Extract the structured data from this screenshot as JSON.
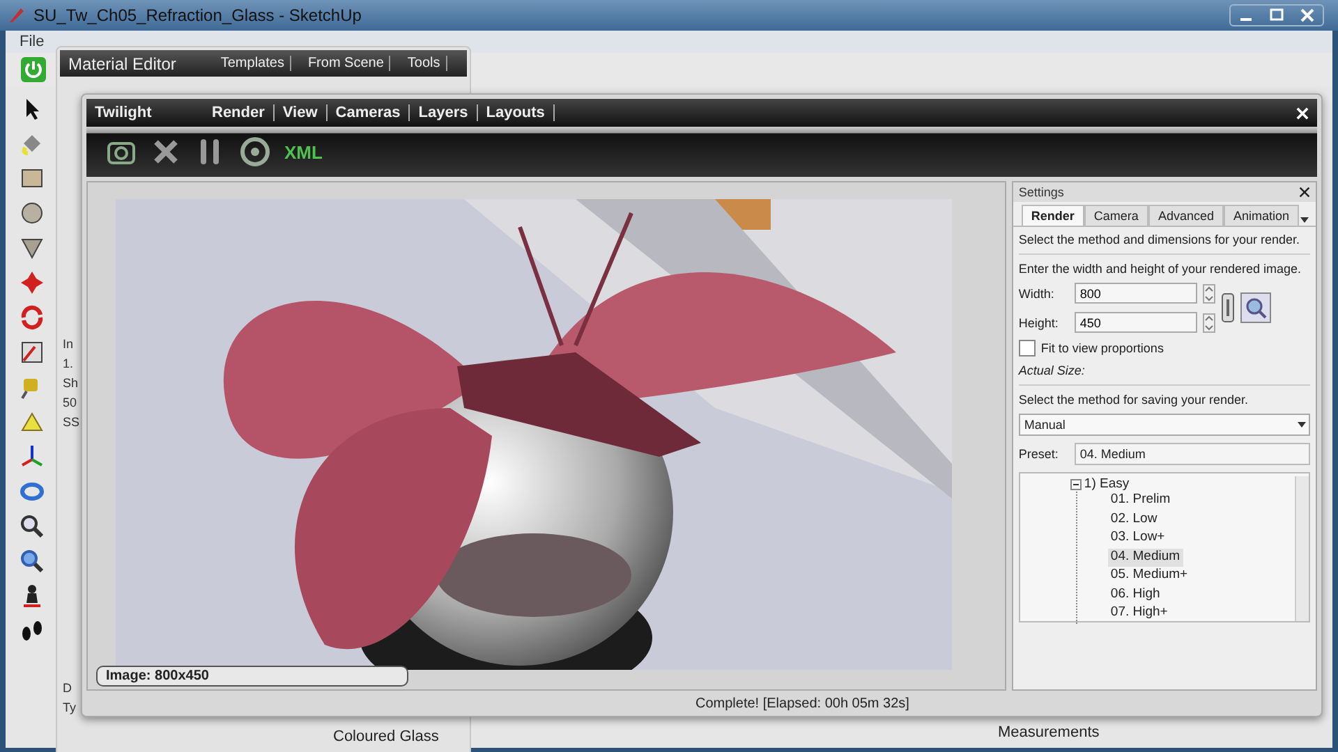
{
  "window": {
    "title": "SU_Tw_Ch05_Refraction_Glass - SketchUp"
  },
  "menu": [
    "File"
  ],
  "status_bar": {
    "label": "Measurements"
  },
  "material_editor": {
    "title": "Material Editor",
    "menu": [
      "Templates",
      "From Scene",
      "Tools"
    ],
    "partial_labels_upper": [
      "In",
      "1.",
      "Sh",
      "50",
      "SS"
    ],
    "partial_labels_lower": [
      "D",
      "Ty"
    ],
    "material_name": "Coloured Glass"
  },
  "twilight": {
    "title": "Twilight",
    "menu": [
      "Render",
      "View",
      "Cameras",
      "Layers",
      "Layouts"
    ],
    "toolbar_text": "XML",
    "image_label": "Image: 800x450",
    "status": "Complete!  [Elapsed: 00h 05m 32s]",
    "settings": {
      "title": "Settings",
      "tabs": [
        {
          "label": "Render",
          "selected": true
        },
        {
          "label": "Camera",
          "selected": false
        },
        {
          "label": "Advanced",
          "selected": false
        },
        {
          "label": "Animation",
          "selected": false
        }
      ],
      "intro": "Select the method and dimensions for your render.",
      "size_hint": "Enter the width and height of your rendered image.",
      "width": {
        "label": "Width:",
        "value": "800"
      },
      "height": {
        "label": "Height:",
        "value": "450"
      },
      "fit": {
        "label": "Fit to view proportions",
        "checked": false
      },
      "actual_size": "Actual Size:",
      "save_hint": "Select the method for saving your render.",
      "save_method": "Manual",
      "preset": {
        "label": "Preset:",
        "value": "04. Medium"
      },
      "tree": [
        {
          "label": "1) Easy",
          "expanded": true,
          "children": [
            {
              "label": "01. Prelim",
              "selected": false
            },
            {
              "label": "02. Low",
              "selected": false
            },
            {
              "label": "03. Low+",
              "selected": false
            },
            {
              "label": "04. Medium",
              "selected": true
            },
            {
              "label": "05. Medium+",
              "selected": false
            },
            {
              "label": "06. High",
              "selected": false
            },
            {
              "label": "07. High+",
              "selected": false
            }
          ]
        }
      ]
    }
  }
}
